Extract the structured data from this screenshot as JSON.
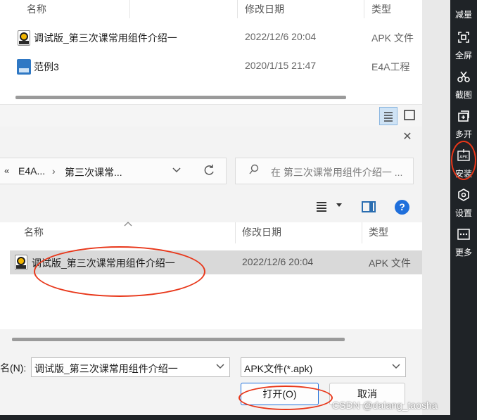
{
  "back_window": {
    "columns": {
      "name": "名称",
      "date": "修改日期",
      "type": "类型"
    },
    "rows": [
      {
        "name": "调试版_第三次课常用组件介绍一",
        "date": "2022/12/6 20:04",
        "type": "APK 文件",
        "icon": "apk-file-icon"
      },
      {
        "name": "范例3",
        "date": "2020/1/15 21:47",
        "type": "E4A工程",
        "icon": "e4a-project-icon"
      }
    ]
  },
  "toolbar": {
    "items": [
      {
        "label": "减量",
        "icon": "decrease-icon"
      },
      {
        "label": "全屏",
        "icon": "fullscreen-icon"
      },
      {
        "label": "截图",
        "icon": "scissors-icon"
      },
      {
        "label": "多开",
        "icon": "multi-open-icon"
      },
      {
        "label": "安装",
        "icon": "apk-install-icon"
      },
      {
        "label": "设置",
        "icon": "settings-icon"
      },
      {
        "label": "更多",
        "icon": "more-icon"
      }
    ]
  },
  "dialog": {
    "close_glyph": "✕",
    "breadcrumb": {
      "more": "«",
      "items": [
        "E4A...",
        "第三次课常..."
      ],
      "separator": "›"
    },
    "search_placeholder": "在 第三次课常用组件介绍一 ...",
    "columns": {
      "name": "名称",
      "date": "修改日期",
      "type": "类型"
    },
    "selected_file": {
      "name": "调试版_第三次课常用组件介绍一",
      "date": "2022/12/6 20:04",
      "type": "APK 文件"
    },
    "filename_label": "名(N):",
    "filename_value": "调试版_第三次课常用组件介绍一",
    "filetype_value": "APK文件(*.apk)",
    "open_button": "打开(O)",
    "cancel_button": "取消",
    "help_glyph": "?"
  },
  "watermark": "CSDN @dalang_taosha",
  "colors": {
    "highlight": "#e8371a",
    "toolbar_bg": "#1f2327",
    "selection": "#d9d9d9",
    "accent": "#1f6fdb"
  }
}
